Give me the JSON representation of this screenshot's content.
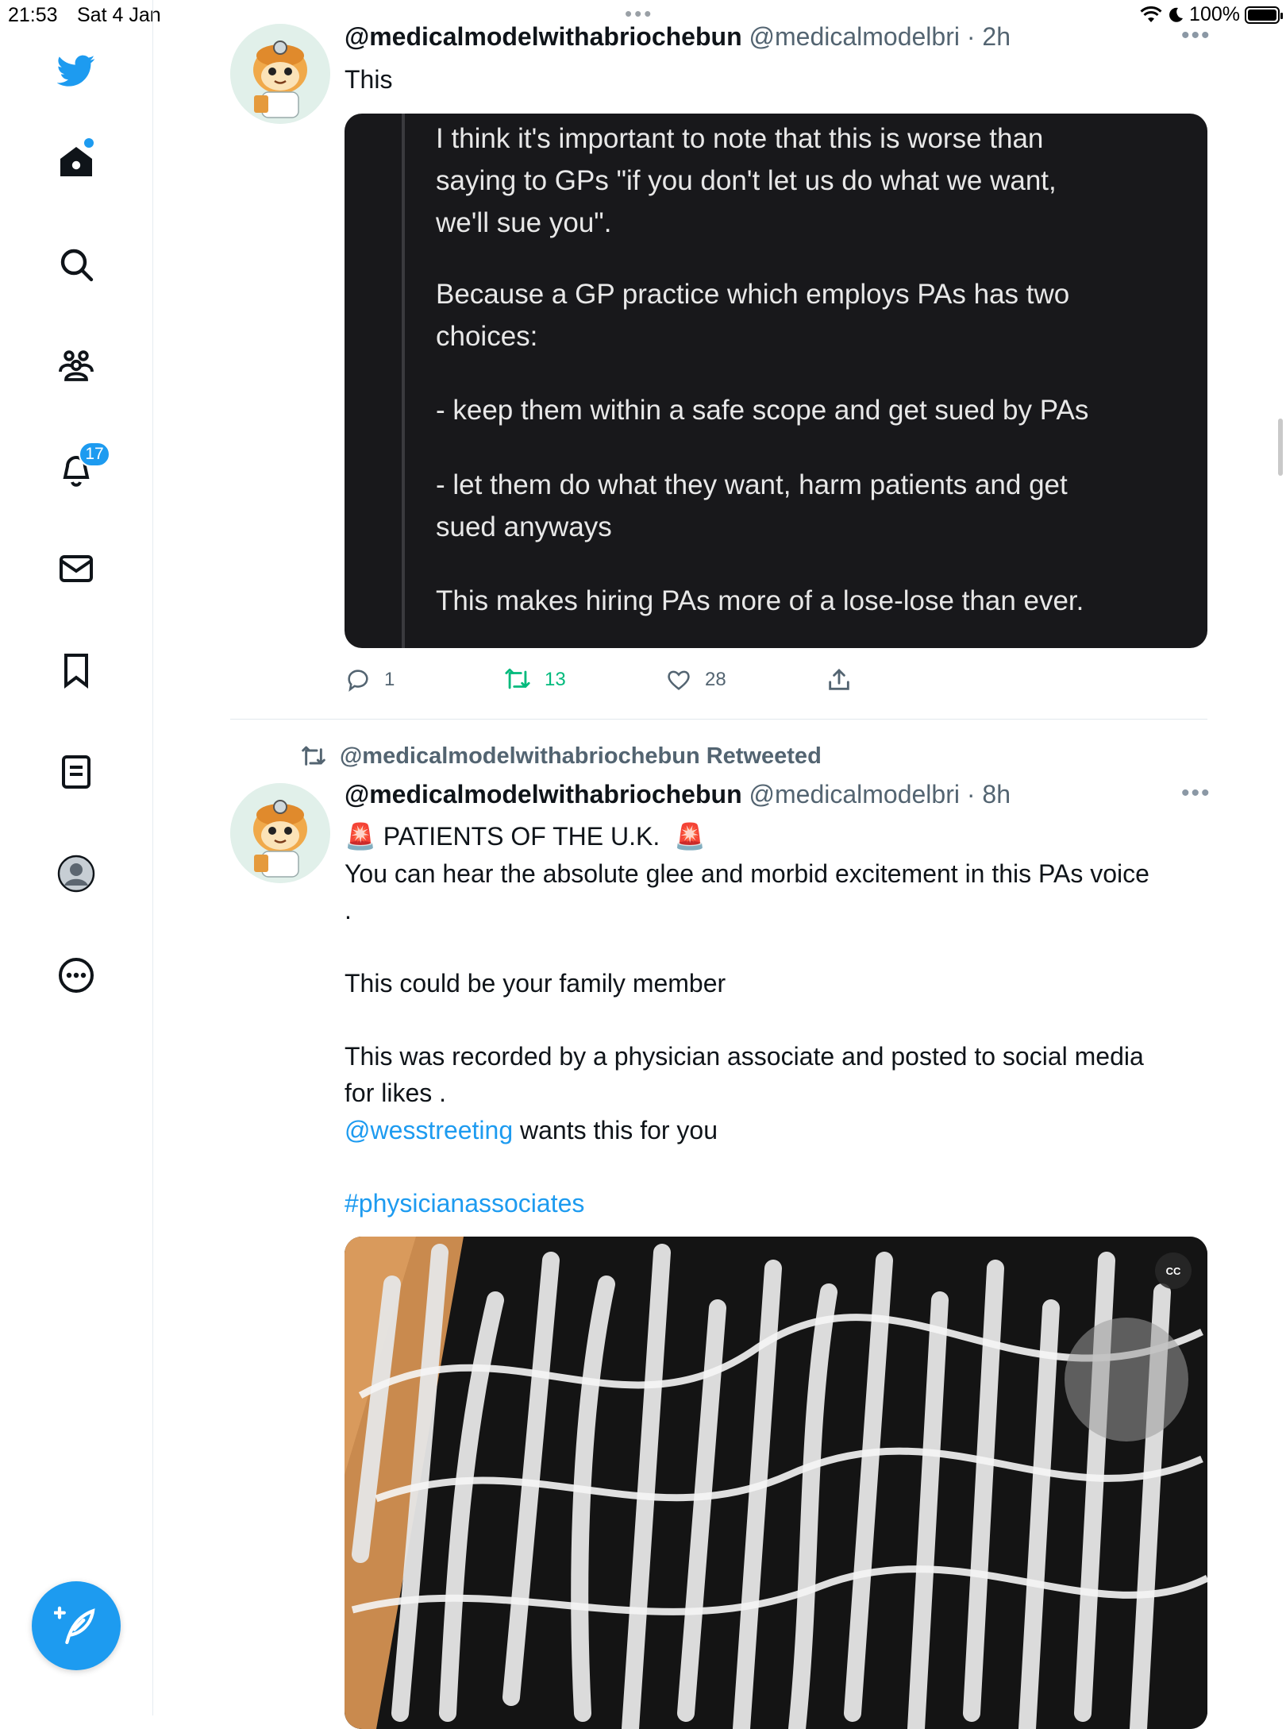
{
  "status_bar": {
    "time": "21:53",
    "date": "Sat 4 Jan",
    "battery": "100%"
  },
  "sidebar": {
    "notifications_badge": "17",
    "items": [
      "twitter-logo",
      "home",
      "explore",
      "communities",
      "notifications",
      "messages",
      "bookmarks",
      "lists",
      "profile",
      "more"
    ]
  },
  "tweets": [
    {
      "name": "@medicalmodelwithabriochebun",
      "handle": "@medicalmodelbri",
      "time": "· 2h",
      "text": "This",
      "quote_image_text": [
        "I think it's important to note that this is worse than\nsaying to GPs \"if you don't let us do what we want,\nwe'll sue you\".",
        "Because a GP practice which employs PAs has two\nchoices:",
        "- keep them within a safe scope and get sued by PAs",
        "- let them do what they want, harm patients and get\nsued anyways",
        "This makes hiring PAs more of a lose-lose than ever."
      ],
      "replies": "1",
      "retweets": "13",
      "likes": "28"
    },
    {
      "retweeted_by": "@medicalmodelwithabriochebun Retweeted",
      "name": "@medicalmodelwithabriochebun",
      "handle": "@medicalmodelbri",
      "time": "· 8h",
      "line1": "🚨 PATIENTS OF THE U.K.  🚨",
      "line2": "You can hear the absolute glee and morbid excitement in this PAs voice\n.",
      "line3": "This could be your family member",
      "line4": "This was recorded by a physician associate and posted to social media\nfor likes .",
      "mention": "@wesstreeting",
      "mention_rest": " wants this for you",
      "hashtag": "#physicianassociates",
      "cc_label": "CC"
    }
  ],
  "colors": {
    "accent": "#1d9bf0",
    "retweet_green": "#00ba7c",
    "text": "#0f1419",
    "muted": "#536471"
  }
}
